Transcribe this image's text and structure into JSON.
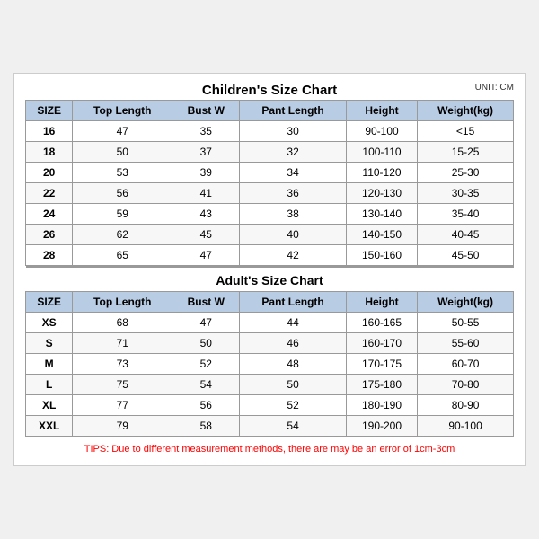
{
  "title": "Children's Size Chart",
  "unit": "UNIT: CM",
  "children_headers": [
    "SIZE",
    "Top Length",
    "Bust W",
    "Pant Length",
    "Height",
    "Weight(kg)"
  ],
  "children_rows": [
    [
      "16",
      "47",
      "35",
      "30",
      "90-100",
      "<15"
    ],
    [
      "18",
      "50",
      "37",
      "32",
      "100-110",
      "15-25"
    ],
    [
      "20",
      "53",
      "39",
      "34",
      "110-120",
      "25-30"
    ],
    [
      "22",
      "56",
      "41",
      "36",
      "120-130",
      "30-35"
    ],
    [
      "24",
      "59",
      "43",
      "38",
      "130-140",
      "35-40"
    ],
    [
      "26",
      "62",
      "45",
      "40",
      "140-150",
      "40-45"
    ],
    [
      "28",
      "65",
      "47",
      "42",
      "150-160",
      "45-50"
    ]
  ],
  "adult_title": "Adult's Size Chart",
  "adult_headers": [
    "SIZE",
    "Top Length",
    "Bust W",
    "Pant Length",
    "Height",
    "Weight(kg)"
  ],
  "adult_rows": [
    [
      "XS",
      "68",
      "47",
      "44",
      "160-165",
      "50-55"
    ],
    [
      "S",
      "71",
      "50",
      "46",
      "160-170",
      "55-60"
    ],
    [
      "M",
      "73",
      "52",
      "48",
      "170-175",
      "60-70"
    ],
    [
      "L",
      "75",
      "54",
      "50",
      "175-180",
      "70-80"
    ],
    [
      "XL",
      "77",
      "56",
      "52",
      "180-190",
      "80-90"
    ],
    [
      "XXL",
      "79",
      "58",
      "54",
      "190-200",
      "90-100"
    ]
  ],
  "tips": "TIPS: Due to different measurement methods, there are may be an error of 1cm-3cm"
}
